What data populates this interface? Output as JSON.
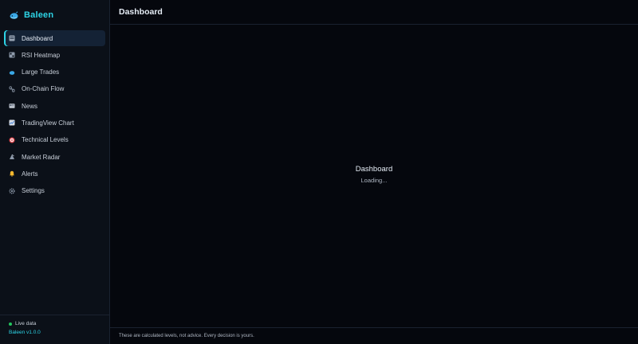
{
  "brand": {
    "name": "Baleen",
    "logo_icon": "whale-icon",
    "accent": "#2dd4e6"
  },
  "sidebar": {
    "items": [
      {
        "label": "Dashboard",
        "icon": "dashboard-icon",
        "active": true
      },
      {
        "label": "RSI Heatmap",
        "icon": "heatmap-icon",
        "active": false
      },
      {
        "label": "Large Trades",
        "icon": "whale-icon",
        "active": false
      },
      {
        "label": "On-Chain Flow",
        "icon": "chain-icon",
        "active": false
      },
      {
        "label": "News",
        "icon": "newspaper-icon",
        "active": false
      },
      {
        "label": "TradingView Chart",
        "icon": "chart-icon",
        "active": false
      },
      {
        "label": "Technical Levels",
        "icon": "target-icon",
        "active": false
      },
      {
        "label": "Market Radar",
        "icon": "radar-icon",
        "active": false
      },
      {
        "label": "Alerts",
        "icon": "bell-icon",
        "active": false
      },
      {
        "label": "Settings",
        "icon": "gear-icon",
        "active": false
      }
    ],
    "footer": {
      "live_label": "Live data",
      "live_color": "#22c55e",
      "version": "Baleen v1.0.0"
    }
  },
  "header": {
    "title": "Dashboard"
  },
  "main": {
    "panel_title": "Dashboard",
    "status": "Loading...",
    "disclaimer": "These are calculated levels, not advice. Every decision is yours."
  }
}
